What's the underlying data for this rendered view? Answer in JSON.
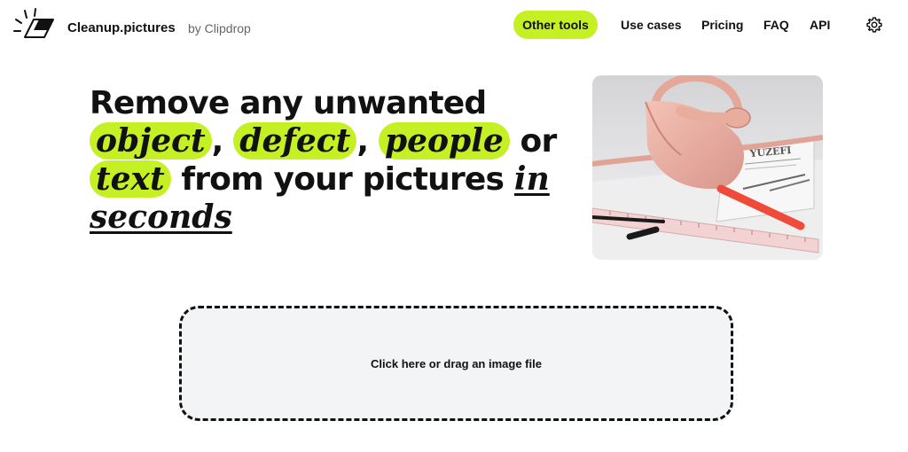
{
  "header": {
    "brand": "Cleanup.pictures",
    "brand_by": "by Clipdrop",
    "nav": {
      "other_tools": "Other tools",
      "use_cases": "Use cases",
      "pricing": "Pricing",
      "faq": "FAQ",
      "api": "API"
    },
    "icons": [
      "eraser-logo-icon",
      "gear-icon"
    ]
  },
  "hero": {
    "line1": "Remove any unwanted",
    "w_object": "object",
    "w_defect": "defect",
    "w_people": "people",
    "or": "or",
    "w_text": "text",
    "from": "from your pictures",
    "in": "in",
    "seconds": "seconds",
    "comma": ","
  },
  "dropzone": {
    "label": "Click here or drag an image file"
  },
  "colors": {
    "accent": "#c4f024",
    "text": "#111111",
    "dropzone_bg": "#f3f4f6"
  }
}
